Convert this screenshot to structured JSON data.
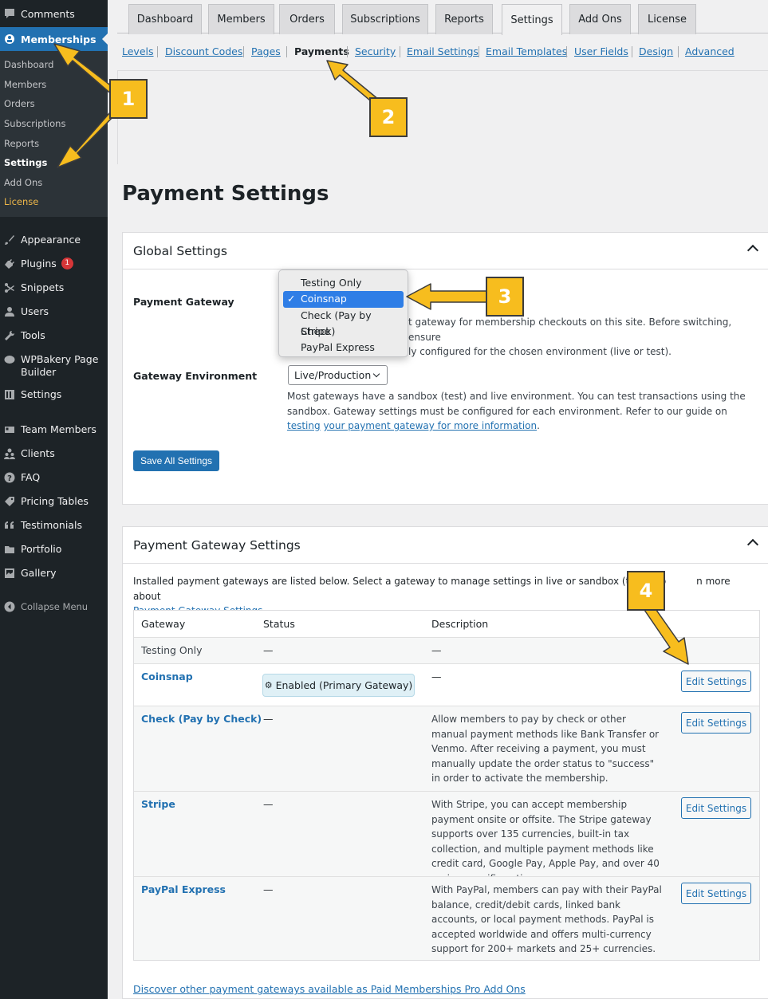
{
  "sidebar": {
    "top_item": "Comments",
    "active_item": "Memberships",
    "submenu": [
      "Dashboard",
      "Members",
      "Orders",
      "Subscriptions",
      "Reports",
      "Settings",
      "Add Ons",
      "License"
    ],
    "items": [
      {
        "label": "Appearance",
        "icon": "brush-icon"
      },
      {
        "label": "Plugins",
        "icon": "plugin-icon",
        "badge": "1"
      },
      {
        "label": "Snippets",
        "icon": "scissors-icon"
      },
      {
        "label": "Users",
        "icon": "user-icon"
      },
      {
        "label": "Tools",
        "icon": "wrench-icon"
      },
      {
        "label": "WPBakery Page Builder",
        "icon": "bakery-icon"
      },
      {
        "label": "Settings",
        "icon": "settings-icon"
      },
      {
        "label": "Team Members",
        "icon": "id-card-icon"
      },
      {
        "label": "Clients",
        "icon": "users-icon"
      },
      {
        "label": "FAQ",
        "icon": "question-icon"
      },
      {
        "label": "Pricing Tables",
        "icon": "tag-icon"
      },
      {
        "label": "Testimonials",
        "icon": "quote-icon"
      },
      {
        "label": "Portfolio",
        "icon": "folder-icon"
      },
      {
        "label": "Gallery",
        "icon": "gallery-icon"
      }
    ],
    "collapse": "Collapse Menu"
  },
  "tabs": [
    "Dashboard",
    "Members",
    "Orders",
    "Subscriptions",
    "Reports",
    "Settings",
    "Add Ons",
    "License"
  ],
  "active_tab": "Settings",
  "subnav": [
    "Levels",
    "Discount Codes",
    "Pages",
    "Payments",
    "Security",
    "Email Settings",
    "Email Templates",
    "User Fields",
    "Design",
    "Advanced"
  ],
  "active_subnav": "Payments",
  "page_title": "Payment Settings",
  "global": {
    "title": "Global Settings",
    "gateway_label": "Payment Gateway",
    "gateway_options": [
      "Testing Only",
      "Coinsnap",
      "Check (Pay by Check)",
      "Stripe",
      "PayPal Express"
    ],
    "gateway_selected": "Coinsnap",
    "gateway_desc_1": "t gateway for membership checkouts on this site. Before switching, ensure",
    "gateway_desc_2": "ly configured for the chosen environment (live or test).",
    "env_label": "Gateway Environment",
    "env_value": "Live/Production",
    "env_desc_1": "Most gateways have a sandbox (test) and live environment. You can test transactions using the",
    "env_desc_2": "sandbox. Gateway settings must be configured for each environment. Refer to our guide on",
    "env_link_1": "testing",
    "env_link_2": "your payment gateway for more information",
    "env_desc_end": ".",
    "save": "Save All Settings"
  },
  "gateway_settings": {
    "title": "Payment Gateway Settings",
    "intro_1": "Installed payment gateways are listed below. Select a gateway to manage settings in live or sandbox (test) mo",
    "intro_1b": "n more about",
    "intro_link": "Payment Gateway Settings",
    "intro_end": ".",
    "columns": [
      "Gateway",
      "Status",
      "Description"
    ],
    "rows": [
      {
        "name": "Testing Only",
        "status": "—",
        "desc": "—"
      },
      {
        "name": "Coinsnap",
        "status": "Enabled (Primary Gateway)",
        "desc": "—",
        "button": "Edit Settings"
      },
      {
        "name": "Check (Pay by Check)",
        "status": "—",
        "desc": "Allow members to pay by check or other manual payment methods like Bank Transfer or Venmo. After receiving a payment, you must manually update the order status to \"success\" in order to activate the membership.",
        "button": "Edit Settings"
      },
      {
        "name": "Stripe",
        "status": "—",
        "desc": "With Stripe, you can accept membership payment onsite or offsite. The Stripe gateway supports over 135 currencies, built-in tax collection, and multiple payment methods like credit card, Google Pay, Apple Pay, and over 40 region-specific options.",
        "button": "Edit Settings"
      },
      {
        "name": "PayPal Express",
        "status": "—",
        "desc": "With PayPal, members can pay with their PayPal balance, credit/debit cards, linked bank accounts, or local payment methods. PayPal is accepted worldwide and offers multi-currency support for 200+ markets and 25+ currencies.",
        "button": "Edit Settings"
      }
    ],
    "discover": "Discover other payment gateways available as Paid Memberships Pro Add Ons"
  },
  "callouts": [
    "1",
    "2",
    "3",
    "4"
  ],
  "colors": {
    "accent": "#2271b1",
    "callout": "#f7bd1e",
    "sidebar": "#1d2327"
  }
}
